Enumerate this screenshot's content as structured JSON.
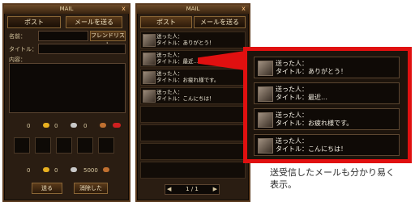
{
  "left_panel": {
    "title": "MAIL",
    "close": "x",
    "tabs": [
      {
        "label": "ポスト"
      },
      {
        "label": "メールを送る"
      }
    ],
    "name_label": "名前：",
    "title_label": "タイトル：",
    "content_label": "内容：",
    "friend_list_button": "フレンドリスト",
    "coins_row1": [
      {
        "amount": "0"
      },
      {
        "amount": "0"
      },
      {
        "amount": "0"
      }
    ],
    "coins_row2": [
      {
        "amount": "0"
      },
      {
        "amount": "0"
      },
      {
        "amount": "5000"
      }
    ],
    "send_button": "送る",
    "cancel_button": "消除した"
  },
  "right_panel": {
    "title": "MAIL",
    "close": "x",
    "tabs": [
      {
        "label": "ポスト"
      },
      {
        "label": "メールを送る"
      }
    ],
    "mails": [
      {
        "line1": "送った人：",
        "line2": "タイトル：ありがとう！"
      },
      {
        "line1": "送った人：",
        "line2": "タイトル：最近…"
      },
      {
        "line1": "送った人：",
        "line2": "タイトル：お疲れ様です。"
      },
      {
        "line1": "送った人：",
        "line2": "タイトル：こんにちは！"
      }
    ],
    "pagination": "1 / 1"
  },
  "callout": {
    "mails": [
      {
        "line1": "送った人：",
        "line2": "タイトル：ありがとう！"
      },
      {
        "line1": "送った人：",
        "line2": "タイトル：最近…"
      },
      {
        "line1": "送った人：",
        "line2": "タイトル：お疲れ様です。"
      },
      {
        "line1": "送った人：",
        "line2": "タイトル：こんにちは！"
      }
    ]
  },
  "caption": {
    "line1": "送受信したメールも分かり易く",
    "line2": "表示。"
  },
  "colors": {
    "callout_border": "#e01010",
    "panel_bg": "#2a1d12",
    "frame": "#5a3a1e"
  }
}
